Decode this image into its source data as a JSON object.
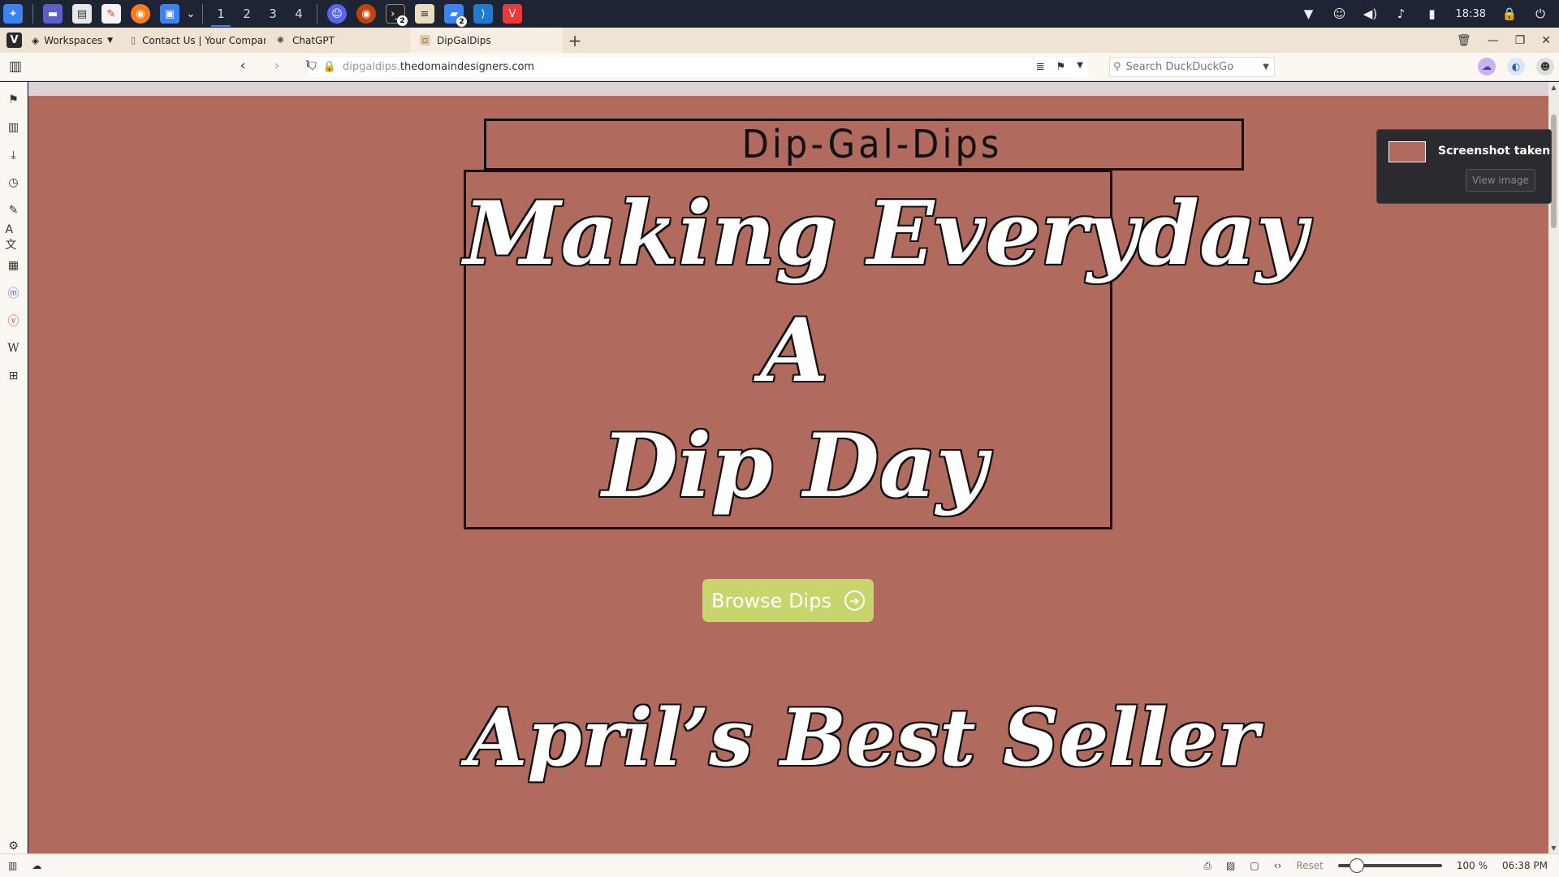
{
  "taskbar": {
    "workspaces": [
      "1",
      "2",
      "3",
      "4"
    ],
    "terminal_badge": "2",
    "files_badge": "2",
    "clock": "18:38"
  },
  "browser": {
    "workspaces_label": "Workspaces",
    "tabs": [
      {
        "label": "Contact Us | Your Company",
        "active": false
      },
      {
        "label": "ChatGPT",
        "active": false
      },
      {
        "label": "DipGalDips",
        "active": true
      }
    ],
    "new_tab": "+",
    "url_dim": "dipgaldips.",
    "url_main": "thedomaindesigners.com",
    "search_placeholder": "Search DuckDuckGo"
  },
  "page": {
    "site_title": "Dip-Gal-Dips",
    "hero_line1": "Making Everyday",
    "hero_line2": "A",
    "hero_line3": "Dip Day",
    "browse_button": "Browse Dips",
    "bestseller_heading": "April’s Best Seller",
    "background_color": "#b06a5e",
    "button_color": "#c8d46c"
  },
  "notification": {
    "title": "Screenshot taken",
    "button": "View image"
  },
  "statusbar": {
    "zoom_reset": "Reset",
    "zoom_level": "100 %",
    "time": "06:38 PM"
  }
}
